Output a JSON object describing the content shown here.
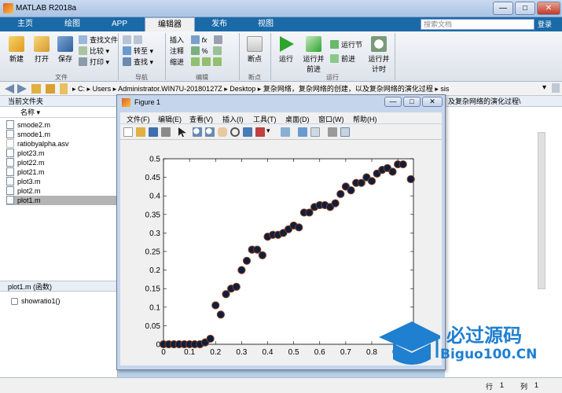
{
  "window": {
    "title": "MATLAB R2018a",
    "minimize": "—",
    "maximize": "□",
    "close": "✕"
  },
  "tabs": [
    "主页",
    "绘图",
    "APP",
    "编辑器",
    "发布",
    "视图"
  ],
  "search": {
    "placeholder": "搜索文档"
  },
  "login": "登录",
  "ribbon": {
    "file": {
      "new": "新建",
      "open": "打开",
      "save": "保存",
      "find_files": "查找文件",
      "compare": "比较",
      "print": "打印",
      "group": "文件"
    },
    "nav": {
      "goto": "转至",
      "find": "查找",
      "group": "导航"
    },
    "edit": {
      "insert": "插入",
      "comment": "注释",
      "indent": "缩进",
      "group": "编辑"
    },
    "breakpoints": {
      "label": "断点",
      "group": "断点"
    },
    "run": {
      "run": "运行",
      "run_advance": "运行并前进",
      "run_section": "运行节",
      "advance": "前进",
      "run_time": "运行并计时",
      "group": "运行"
    }
  },
  "address": {
    "path": [
      "C:",
      "Users",
      "Administrator.WIN7U-20180127Z",
      "Desktop",
      "复杂网络，复杂网络的创建，以及复杂网络的演化过程",
      "sis"
    ]
  },
  "left_panel": {
    "title": "当前文件夹",
    "column": "名称",
    "files": [
      "smode2.m",
      "smode1.m",
      "ratiobyalpha.asv",
      "plot23.m",
      "plot22.m",
      "plot21.m",
      "plot3.m",
      "plot2.m",
      "plot1.m"
    ],
    "details_title": "plot1.m  (函数)",
    "function": "showratio1()"
  },
  "right_panel": {
    "fragment": "及复杂网络的演化过程\\"
  },
  "figure": {
    "title": "Figure 1",
    "menu": [
      "文件(F)",
      "编辑(E)",
      "查看(V)",
      "插入(I)",
      "工具(T)",
      "桌面(D)",
      "窗口(W)",
      "帮助(H)"
    ]
  },
  "chart_data": {
    "type": "scatter",
    "xticks": [
      "0",
      "0.1",
      "0.2",
      "0.3",
      "0.4",
      "0.5",
      "0.6",
      "0.7",
      "0.8",
      "0.9"
    ],
    "yticks": [
      "0",
      "0.05",
      "0.1",
      "0.15",
      "0.2",
      "0.25",
      "0.3",
      "0.35",
      "0.4",
      "0.45",
      "0.5"
    ],
    "xlim": [
      0,
      0.96
    ],
    "ylim": [
      0,
      0.5
    ],
    "marker_color": "#0d1f3c",
    "marker_edge": "#8b3a1a",
    "x": [
      0,
      0.02,
      0.04,
      0.06,
      0.08,
      0.1,
      0.12,
      0.14,
      0.16,
      0.18,
      0.2,
      0.22,
      0.24,
      0.26,
      0.28,
      0.3,
      0.32,
      0.34,
      0.36,
      0.38,
      0.4,
      0.42,
      0.44,
      0.46,
      0.48,
      0.5,
      0.52,
      0.54,
      0.56,
      0.58,
      0.6,
      0.62,
      0.64,
      0.66,
      0.68,
      0.7,
      0.72,
      0.74,
      0.76,
      0.78,
      0.8,
      0.82,
      0.84,
      0.86,
      0.88,
      0.9,
      0.92,
      0.95
    ],
    "y": [
      0,
      0,
      0,
      0,
      0,
      0,
      0,
      0,
      0.005,
      0.015,
      0.105,
      0.08,
      0.135,
      0.15,
      0.155,
      0.2,
      0.225,
      0.255,
      0.255,
      0.24,
      0.29,
      0.295,
      0.295,
      0.3,
      0.31,
      0.32,
      0.315,
      0.355,
      0.355,
      0.37,
      0.375,
      0.375,
      0.37,
      0.38,
      0.405,
      0.425,
      0.415,
      0.435,
      0.435,
      0.45,
      0.44,
      0.46,
      0.47,
      0.475,
      0.465,
      0.485,
      0.485,
      0.445
    ]
  },
  "status": {
    "row_label": "行",
    "row": "1",
    "col_label": "列",
    "col": "1"
  },
  "watermark": {
    "text": "必过源码",
    "url": "Biguo100.CN"
  }
}
